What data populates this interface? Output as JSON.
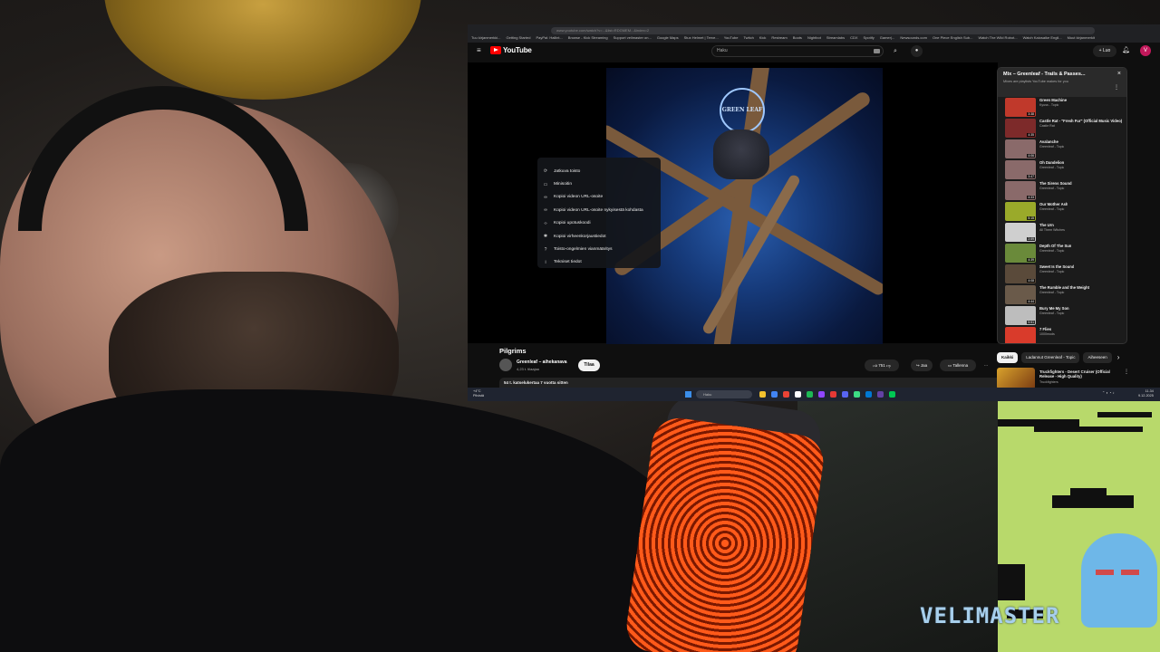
{
  "browser": {
    "url": "www.youtube.com/watch?v=...&list=RDGMEM...&index=2",
    "bookmarks": [
      "Tuu kirjanmerkki...",
      "Getting Started",
      "PayPal: Hallint...",
      "Browse - Kick Streaming",
      "Support veilmaster on...",
      "Google Maps",
      "Stux Helmet | Terve...",
      "YouTube",
      "Twitch",
      "Kick",
      "Restream",
      "Boots",
      "Nightbot",
      "Streamlabs",
      "CDX",
      "Spotify",
      "Gamer|...",
      "Newsounds.com",
      "One Piece English Sub...",
      "Watch The Wild Robot...",
      "Watch Kaiosaike Engli...",
      "Muut kirjanmerkit"
    ]
  },
  "youtube": {
    "logo_text": "YouTube",
    "search_placeholder": "Haku",
    "create_label": "+ Luo",
    "avatar_letter": "V",
    "context_menu": [
      {
        "icon": "loop-icon",
        "glyph": "⟳",
        "label": "Jatkuva toisto"
      },
      {
        "icon": "miniplayer-icon",
        "glyph": "▭",
        "label": "Minisoitin"
      },
      {
        "icon": "link-icon",
        "glyph": "∞",
        "label": "Kopioi videon URL-osoite"
      },
      {
        "icon": "link-time-icon",
        "glyph": "∞",
        "label": "Kopioi videon URL-osoite nykyisestä kohdasta"
      },
      {
        "icon": "embed-icon",
        "glyph": "‹›",
        "label": "Kopioi upotuskoodi"
      },
      {
        "icon": "debug-icon",
        "glyph": "✱",
        "label": "Kopioi virheenkorjaustiedot"
      },
      {
        "icon": "troubleshoot-icon",
        "glyph": "?",
        "label": "Toisto-ongelmien vianmääritys"
      },
      {
        "icon": "info-icon",
        "glyph": "i",
        "label": "Tekniset tiedot"
      }
    ],
    "album_logo": "GREEN LEAF",
    "video_title": "Pilgrims",
    "channel_name": "Greenleaf – aihekanava",
    "subscriber_count": "4,23 t. tilaajaa",
    "subscribe_label": "Tilaa",
    "like_count": "751",
    "share_label": "Jaa",
    "save_label": "Tallenna",
    "more_glyph": "···",
    "description_meta": "54 t. katselukertaa  7 vuotta sitten",
    "playlist": {
      "title": "Mix – Greenleaf - Trails & Passes...",
      "subtitle": "Mixes are playlists YouTube makes for you",
      "items": [
        {
          "title": "Green Machine",
          "channel": "Kyuss - Topic",
          "duration": "3:38",
          "color": "#c0392b"
        },
        {
          "title": "Castle Rat - \"Fresh Fur\" (Official Music Video)",
          "channel": "Castle Rat",
          "duration": "4:35",
          "color": "#7d2a2a"
        },
        {
          "title": "Avalanche",
          "channel": "Greenleaf - Topic",
          "duration": "4:06",
          "color": "#8a6a6a"
        },
        {
          "title": "Oh Dandelion",
          "channel": "Greenleaf - Topic",
          "duration": "3:47",
          "color": "#8a6a6a"
        },
        {
          "title": "The Sirens Sound",
          "channel": "Greenleaf - Topic",
          "duration": "4:33",
          "color": "#8a6a6a"
        },
        {
          "title": "Our Mother Ash",
          "channel": "Greenleaf - Topic",
          "duration": "5:15",
          "color": "#9aaa2a"
        },
        {
          "title": "The Urn",
          "channel": "All Them Witches",
          "duration": "2:59",
          "color": "#cfcfcf"
        },
        {
          "title": "Depth Of The Sun",
          "channel": "Greenleaf - Topic",
          "duration": "4:39",
          "color": "#6a8a3a"
        },
        {
          "title": "Sweet Is the Sound",
          "channel": "Greenleaf - Topic",
          "duration": "4:08",
          "color": "#5a4a3a"
        },
        {
          "title": "The Rumble and the Weight",
          "channel": "Greenleaf - Topic",
          "duration": "4:44",
          "color": "#6a5a4a"
        },
        {
          "title": "Bury Me My Son",
          "channel": "Greenleaf - Topic",
          "duration": "5:51",
          "color": "#bdbdbd"
        },
        {
          "title": "7 Flies",
          "channel": "1000mods",
          "duration": "",
          "color": "#d93b2b"
        }
      ]
    },
    "chips": [
      "Kaikki",
      "Ladannut Greenleaf - Topic",
      "Aiheeseen"
    ],
    "recommended": {
      "title": "Truckfighters - Desert Cruiser (Official Release - High Quality)",
      "channel": "Truckfighters"
    }
  },
  "taskbar": {
    "weather_temp": "+4°C",
    "weather_text": "Pilvistä",
    "search_label": "Haku",
    "time": "11.34",
    "date": "9.12.2025",
    "app_colors": [
      "#f2c12e",
      "#4285f4",
      "#ea4335",
      "#ffffff",
      "#1db954",
      "#9146ff",
      "#e53935",
      "#5865f2",
      "#3ddc84",
      "#0078d4",
      "#6441a5",
      "#00c853"
    ]
  },
  "overlay": {
    "watermark": "VELIMASTER"
  }
}
